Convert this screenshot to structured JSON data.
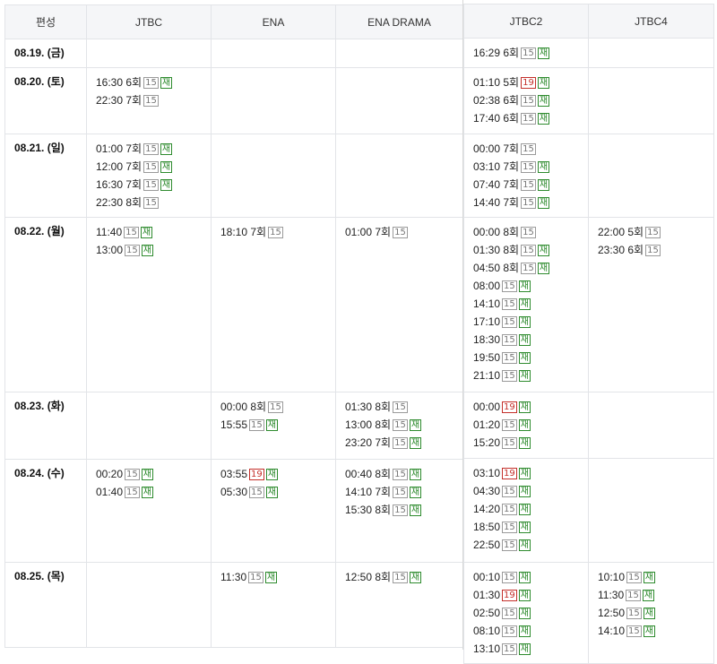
{
  "left": {
    "headers": [
      "편성",
      "JTBC",
      "ENA",
      "ENA DRAMA"
    ],
    "rows": [
      {
        "date": "08.19. (금)",
        "cells": [
          [],
          [],
          []
        ]
      },
      {
        "date": "08.20. (토)",
        "cells": [
          [
            {
              "t": "16:30 6회",
              "r": "15",
              "re": true
            },
            {
              "t": "22:30 7회",
              "r": "15",
              "re": false
            }
          ],
          [],
          []
        ]
      },
      {
        "date": "08.21. (일)",
        "cells": [
          [
            {
              "t": "01:00 7회",
              "r": "15",
              "re": true
            },
            {
              "t": "12:00 7회",
              "r": "15",
              "re": true
            },
            {
              "t": "16:30 7회",
              "r": "15",
              "re": true
            },
            {
              "t": "22:30 8회",
              "r": "15",
              "re": false
            }
          ],
          [],
          []
        ]
      },
      {
        "date": "08.22. (월)",
        "cells": [
          [
            {
              "t": "11:40",
              "r": "15",
              "re": true
            },
            {
              "t": "13:00",
              "r": "15",
              "re": true
            }
          ],
          [
            {
              "t": "18:10 7회",
              "r": "15",
              "re": false
            }
          ],
          [
            {
              "t": "01:00 7회",
              "r": "15",
              "re": false
            }
          ]
        ]
      },
      {
        "date": "08.23. (화)",
        "cells": [
          [],
          [
            {
              "t": "00:00 8회",
              "r": "15",
              "re": false
            },
            {
              "t": "15:55",
              "r": "15",
              "re": true
            }
          ],
          [
            {
              "t": "01:30 8회",
              "r": "15",
              "re": false
            },
            {
              "t": "13:00 8회",
              "r": "15",
              "re": true
            },
            {
              "t": "23:20 7회",
              "r": "15",
              "re": true
            }
          ]
        ]
      },
      {
        "date": "08.24. (수)",
        "cells": [
          [
            {
              "t": "00:20",
              "r": "15",
              "re": true
            },
            {
              "t": "01:40",
              "r": "15",
              "re": true
            }
          ],
          [
            {
              "t": "03:55",
              "r": "19",
              "re": true
            },
            {
              "t": "05:30",
              "r": "15",
              "re": true
            }
          ],
          [
            {
              "t": "00:40 8회",
              "r": "15",
              "re": true
            },
            {
              "t": "14:10 7회",
              "r": "15",
              "re": true
            },
            {
              "t": "15:30 8회",
              "r": "15",
              "re": true
            }
          ]
        ]
      },
      {
        "date": "08.25. (목)",
        "cells": [
          [],
          [
            {
              "t": "11:30",
              "r": "15",
              "re": true
            }
          ],
          [
            {
              "t": "12:50 8회",
              "r": "15",
              "re": true
            }
          ]
        ]
      }
    ]
  },
  "right": {
    "headers": [
      "JTBC2",
      "JTBC4"
    ],
    "rows": [
      {
        "cells": [
          [
            {
              "t": "16:29 6회",
              "r": "15",
              "re": true
            }
          ],
          []
        ]
      },
      {
        "cells": [
          [
            {
              "t": "01:10 5회",
              "r": "19",
              "re": true
            },
            {
              "t": "02:38 6회",
              "r": "15",
              "re": true
            },
            {
              "t": "17:40 6회",
              "r": "15",
              "re": true
            }
          ],
          []
        ]
      },
      {
        "cells": [
          [
            {
              "t": "00:00 7회",
              "r": "15",
              "re": false
            },
            {
              "t": "03:10 7회",
              "r": "15",
              "re": true
            },
            {
              "t": "07:40 7회",
              "r": "15",
              "re": true
            },
            {
              "t": "14:40 7회",
              "r": "15",
              "re": true
            }
          ],
          []
        ]
      },
      {
        "cells": [
          [
            {
              "t": "00:00 8회",
              "r": "15",
              "re": false
            },
            {
              "t": "01:30 8회",
              "r": "15",
              "re": true
            },
            {
              "t": "04:50 8회",
              "r": "15",
              "re": true
            },
            {
              "t": "08:00",
              "r": "15",
              "re": true
            },
            {
              "t": "14:10",
              "r": "15",
              "re": true
            },
            {
              "t": "17:10",
              "r": "15",
              "re": true
            },
            {
              "t": "18:30",
              "r": "15",
              "re": true
            },
            {
              "t": "19:50",
              "r": "15",
              "re": true
            },
            {
              "t": "21:10",
              "r": "15",
              "re": true
            }
          ],
          [
            {
              "t": "22:00 5회",
              "r": "15",
              "re": false
            },
            {
              "t": "23:30 6회",
              "r": "15",
              "re": false
            }
          ]
        ]
      },
      {
        "cells": [
          [
            {
              "t": "00:00",
              "r": "19",
              "re": true
            },
            {
              "t": "01:20",
              "r": "15",
              "re": true
            },
            {
              "t": "15:20",
              "r": "15",
              "re": true
            }
          ],
          []
        ]
      },
      {
        "cells": [
          [
            {
              "t": "03:10",
              "r": "19",
              "re": true
            },
            {
              "t": "04:30",
              "r": "15",
              "re": true
            },
            {
              "t": "14:20",
              "r": "15",
              "re": true
            },
            {
              "t": "18:50",
              "r": "15",
              "re": true
            },
            {
              "t": "22:50",
              "r": "15",
              "re": true
            }
          ],
          []
        ]
      },
      {
        "cells": [
          [
            {
              "t": "00:10",
              "r": "15",
              "re": true
            },
            {
              "t": "01:30",
              "r": "19",
              "re": true
            },
            {
              "t": "02:50",
              "r": "15",
              "re": true
            },
            {
              "t": "08:10",
              "r": "15",
              "re": true
            },
            {
              "t": "13:10",
              "r": "15",
              "re": true
            }
          ],
          [
            {
              "t": "10:10",
              "r": "15",
              "re": true
            },
            {
              "t": "11:30",
              "r": "15",
              "re": true
            },
            {
              "t": "12:50",
              "r": "15",
              "re": true
            },
            {
              "t": "14:10",
              "r": "15",
              "re": true
            }
          ]
        ]
      }
    ]
  },
  "rerun_label": "재"
}
